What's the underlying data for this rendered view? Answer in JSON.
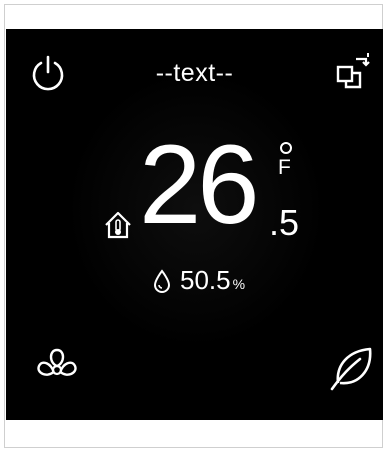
{
  "header": {
    "title": "--text--"
  },
  "temperature": {
    "integer": "26",
    "decimal": ".5",
    "unit": "F"
  },
  "humidity": {
    "value": "50.5",
    "unit": "%"
  },
  "colors": {
    "screen_bg": "#000000",
    "foreground": "#ffffff"
  },
  "icons": {
    "power": "power-icon",
    "mode": "mode-switch-icon",
    "fan": "fan-icon",
    "eco": "leaf-icon",
    "home": "home-thermometer-icon",
    "drop": "water-drop-icon"
  }
}
